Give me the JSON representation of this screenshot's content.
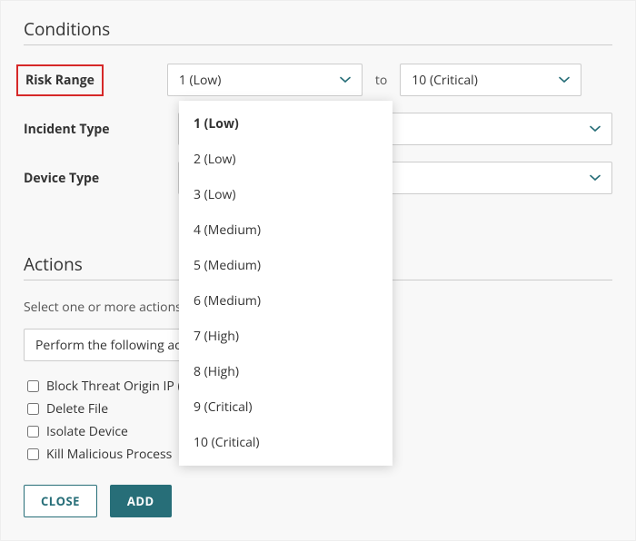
{
  "sections": {
    "conditions_title": "Conditions",
    "actions_title": "Actions"
  },
  "conditions": {
    "risk_range_label": "Risk Range",
    "risk_min_value": "1 (Low)",
    "to_label": "to",
    "risk_max_value": "10 (Critical)",
    "incident_type_label": "Incident Type",
    "incident_type_value": "",
    "device_type_label": "Device Type",
    "device_type_value": ""
  },
  "risk_dropdown": {
    "options": [
      "1 (Low)",
      "2 (Low)",
      "3 (Low)",
      "4 (Medium)",
      "5 (Medium)",
      "6 (Medium)",
      "7 (High)",
      "8 (High)",
      "9 (Critical)",
      "10 (Critical)"
    ],
    "selected_index": 0
  },
  "actions": {
    "instruction": "Select one or more actions for this incident:",
    "perform_label": "Perform the following actions:",
    "checks": [
      {
        "label": "Block Threat Origin IP (on Firebox)",
        "checked": false
      },
      {
        "label": "Delete File",
        "checked": false
      },
      {
        "label": "Isolate Device",
        "checked": false
      },
      {
        "label": "Kill Malicious Process",
        "checked": false
      }
    ]
  },
  "buttons": {
    "close": "CLOSE",
    "add": "ADD"
  },
  "colors": {
    "accent": "#276e78",
    "highlight_border": "#d62828"
  }
}
